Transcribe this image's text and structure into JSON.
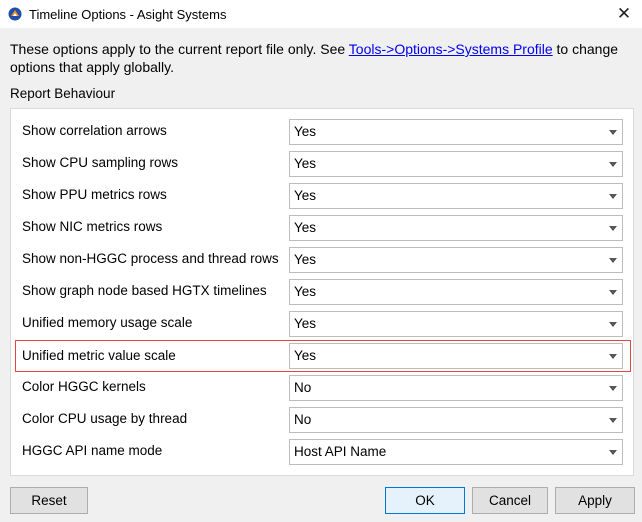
{
  "window": {
    "title": "Timeline Options - Asight Systems",
    "close_glyph": "✕",
    "app_icon": "app-logo-icon"
  },
  "intro": {
    "text_before": "These options apply to the current report file only. See ",
    "link": "Tools->Options->Systems Profile",
    "text_after": " to change options that apply globally."
  },
  "section": {
    "label": "Report Behaviour"
  },
  "rows": [
    {
      "label": "Show correlation arrows",
      "value": "Yes"
    },
    {
      "label": "Show CPU sampling rows",
      "value": "Yes"
    },
    {
      "label": "Show PPU metrics rows",
      "value": "Yes"
    },
    {
      "label": "Show NIC metrics rows",
      "value": "Yes"
    },
    {
      "label": "Show non-HGGC process and thread rows",
      "value": "Yes"
    },
    {
      "label": "Show graph node based HGTX timelines",
      "value": "Yes"
    },
    {
      "label": "Unified memory usage scale",
      "value": "Yes"
    },
    {
      "label": "Unified metric value scale",
      "value": "Yes",
      "highlighted": true
    },
    {
      "label": "Color HGGC kernels",
      "value": "No"
    },
    {
      "label": "Color CPU usage by thread",
      "value": "No"
    },
    {
      "label": "HGGC API name mode",
      "value": "Host API Name"
    }
  ],
  "buttons": {
    "reset": "Reset",
    "ok": "OK",
    "cancel": "Cancel",
    "apply": "Apply"
  },
  "colors": {
    "highlight_border": "#e04848",
    "link": "#0000ee",
    "default_button_border": "#0078d7"
  }
}
